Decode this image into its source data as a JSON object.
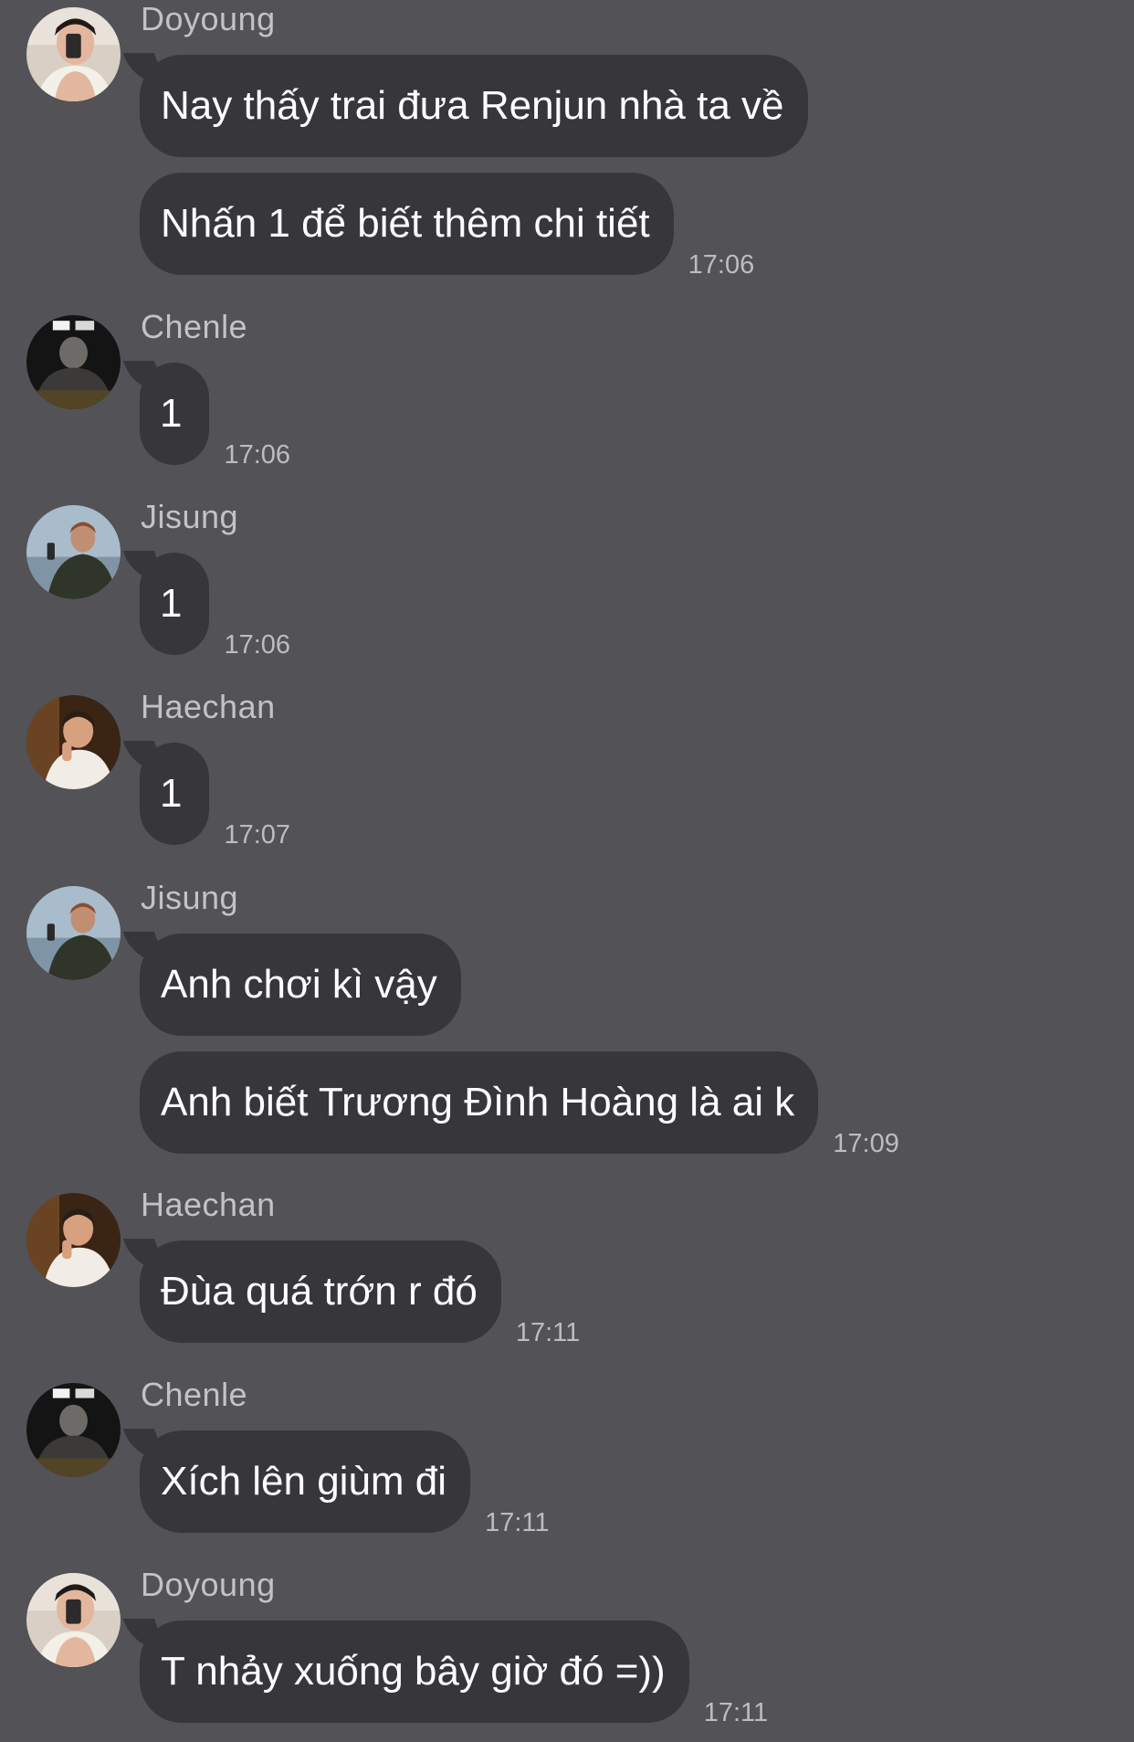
{
  "messages": [
    {
      "sender": "Doyoung",
      "avatar": "doyoung-avatar",
      "lines": [
        "Nay thấy trai đưa Renjun nhà ta về",
        "Nhấn 1 để biết thêm chi tiết"
      ],
      "time": "17:06"
    },
    {
      "sender": "Chenle",
      "avatar": "chenle-avatar",
      "lines": [
        "1"
      ],
      "time": "17:06"
    },
    {
      "sender": "Jisung",
      "avatar": "jisung-avatar",
      "lines": [
        "1"
      ],
      "time": "17:06"
    },
    {
      "sender": "Haechan",
      "avatar": "haechan-avatar",
      "lines": [
        "1"
      ],
      "time": "17:07"
    },
    {
      "sender": "Jisung",
      "avatar": "jisung-avatar",
      "lines": [
        "Anh chơi kì vậy",
        "Anh biết Trương Đình Hoàng là ai k"
      ],
      "time": "17:09"
    },
    {
      "sender": "Haechan",
      "avatar": "haechan-avatar",
      "lines": [
        "Đùa quá trớn r đó"
      ],
      "time": "17:11"
    },
    {
      "sender": "Chenle",
      "avatar": "chenle-avatar",
      "lines": [
        "Xích lên giùm đi"
      ],
      "time": "17:11"
    },
    {
      "sender": "Doyoung",
      "avatar": "doyoung-avatar",
      "lines": [
        "T nhảy xuống bây giờ đó =))"
      ],
      "time": "17:11"
    }
  ],
  "colors": {
    "background": "#535256",
    "bubble": "#37363a",
    "sender_text": "#c3c2c6",
    "time_text": "#bdbcc0",
    "message_text": "#ffffff"
  }
}
